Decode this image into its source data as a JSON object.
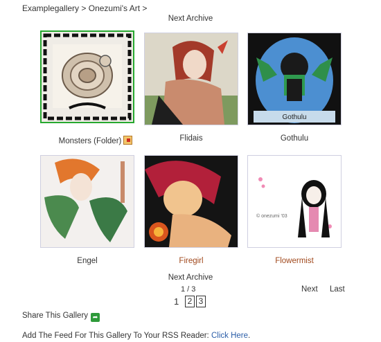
{
  "breadcrumb": {
    "root": "Examplegallery",
    "sep1": ">",
    "current": "Onezumi's Art",
    "sep2": ">"
  },
  "nav": {
    "next_archive_top": "Next Archive",
    "next_archive_bottom": "Next Archive"
  },
  "gallery": {
    "items": [
      {
        "caption": "Monsters (Folder)",
        "type": "folder",
        "icon": "folder-icon"
      },
      {
        "caption": "Flidais",
        "type": "image"
      },
      {
        "caption": "Gothulu",
        "type": "image",
        "image_text": "Gothulu"
      },
      {
        "caption": "Engel",
        "type": "image"
      },
      {
        "caption": "Firegirl",
        "type": "image"
      },
      {
        "caption": "Flowermist",
        "type": "image",
        "image_text": "© onezumi '03"
      }
    ]
  },
  "pagination": {
    "count": "1 / 3",
    "current": "1",
    "pages": [
      "2",
      "3"
    ],
    "next": "Next",
    "last": "Last"
  },
  "share": {
    "label": "Share This Gallery",
    "icon": "share-icon"
  },
  "rss": {
    "text": "Add The Feed For This Gallery To Your RSS Reader: ",
    "link": "Click Here",
    "end": "."
  },
  "colors": {
    "selected_border": "#27a82f",
    "thumb_border": "#cfcfe0",
    "link_red": "#a0481c",
    "rss_link": "#2b5ea8"
  }
}
